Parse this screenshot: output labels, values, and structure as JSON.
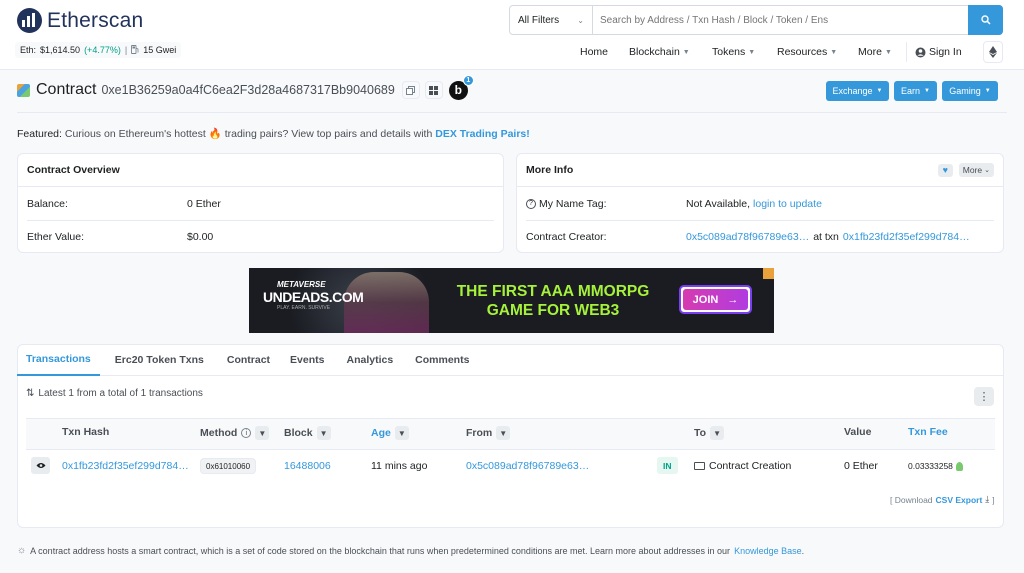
{
  "header": {
    "logo_text": "Etherscan",
    "eth_price_label": "Eth:",
    "eth_price": "$1,614.50",
    "eth_change": "(+4.77%)",
    "separator": "|",
    "gas": "15 Gwei",
    "filter_label": "All Filters",
    "search_placeholder": "Search by Address / Txn Hash / Block / Token / Ens",
    "nav": {
      "home": "Home",
      "blockchain": "Blockchain",
      "tokens": "Tokens",
      "resources": "Resources",
      "more": "More",
      "signin": "Sign In"
    }
  },
  "contract": {
    "label": "Contract",
    "address": "0xe1B36259a0a4fC6ea2F3d28a4687317Bb9040689",
    "b_letter": "b",
    "badge_count": "1",
    "buttons": {
      "exchange": "Exchange",
      "earn": "Earn",
      "gaming": "Gaming"
    }
  },
  "featured": {
    "prefix": "Featured:",
    "text": "Curious on Ethereum's hottest",
    "fire": "🔥",
    "text2": "trading pairs? View top pairs and details with",
    "link": "DEX Trading Pairs!"
  },
  "overview": {
    "title": "Contract Overview",
    "balance_label": "Balance:",
    "balance_value": "0 Ether",
    "ether_value_label": "Ether Value:",
    "ether_value": "$0.00"
  },
  "more_info": {
    "title": "More Info",
    "more_btn": "More",
    "name_tag_label": "My Name Tag:",
    "name_tag_value": "Not Available,",
    "name_tag_link": "login to update",
    "creator_label": "Contract Creator:",
    "creator_address": "0x5c089ad78f96789e63…",
    "at_txn": "at txn",
    "creator_txn": "0x1fb23fd2f35ef299d784…"
  },
  "ad": {
    "brand_top": "METAVERSE",
    "brand_main": "UNDEADS.COM",
    "brand_sub": "PLAY. EARN. SURVIVE",
    "headline_1": "THE FIRST AAA MMORPG",
    "headline_2": "GAME FOR WEB3",
    "cta": "JOIN",
    "cta_arrow": "→"
  },
  "tabs": [
    {
      "label": "Transactions"
    },
    {
      "label": "Erc20 Token Txns"
    },
    {
      "label": "Contract"
    },
    {
      "label": "Events"
    },
    {
      "label": "Analytics"
    },
    {
      "label": "Comments"
    }
  ],
  "transactions": {
    "summary": "Latest 1 from a total of 1 transactions",
    "headers": {
      "hash": "Txn Hash",
      "method": "Method",
      "block": "Block",
      "age": "Age",
      "from": "From",
      "to": "To",
      "value": "Value",
      "fee": "Txn Fee"
    },
    "rows": [
      {
        "hash": "0x1fb23fd2f35ef299d784…",
        "method": "0x61010060",
        "block": "16488006",
        "age": "11 mins ago",
        "from": "0x5c089ad78f96789e63…",
        "direction": "IN",
        "to": "Contract Creation",
        "value": "0 Ether",
        "fee": "0.03333258"
      }
    ],
    "download_prefix": "[ Download",
    "download_link": "CSV Export",
    "download_suffix": "]"
  },
  "footer_note": {
    "text": "A contract address hosts a smart contract, which is a set of code stored on the blockchain that runs when predetermined conditions are met. Learn more about addresses in our",
    "link": "Knowledge Base",
    "end": "."
  }
}
